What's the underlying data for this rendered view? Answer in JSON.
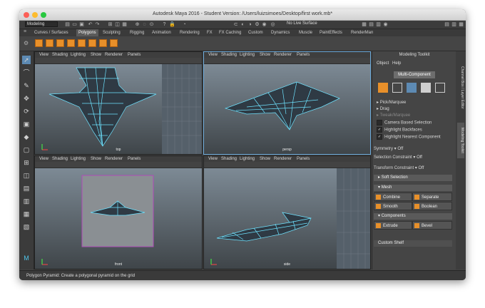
{
  "window": {
    "title": "Autodesk Maya 2016 - Student Version: /Users/luizsimoes/Desktop/first work.mb*",
    "mode": "Modeling",
    "live_surface": "No Live Surface"
  },
  "shelf_tabs": [
    "Curves / Surfaces",
    "Polygons",
    "Sculpting",
    "Rigging",
    "Animation",
    "Rendering",
    "FX",
    "FX Caching",
    "Custom",
    "Dynamics",
    "Muscle",
    "PaintEffects",
    "RenderMan"
  ],
  "active_shelf_tab": "Polygons",
  "viewport_menu": [
    "View",
    "Shading",
    "Lighting",
    "Show",
    "Renderer",
    "Panels"
  ],
  "viewports": [
    {
      "camera": "top"
    },
    {
      "camera": "persp"
    },
    {
      "camera": "front"
    },
    {
      "camera": "side"
    }
  ],
  "modeling_toolkit": {
    "title": "Modeling Toolkit",
    "menu": [
      "Object",
      "Help"
    ],
    "multi_component": "Multi-Component",
    "rows": [
      {
        "label": "Pick/Marquee"
      },
      {
        "label": "Drag"
      },
      {
        "label": "Tweak/Marquee"
      }
    ],
    "checkboxes": [
      {
        "label": "Camera Based Selection",
        "checked": false
      },
      {
        "label": "Highlight Backfaces",
        "checked": true
      },
      {
        "label": "Highlight Nearest Component",
        "checked": true
      }
    ],
    "options": [
      {
        "label": "Symmetry",
        "value": "Off"
      },
      {
        "label": "Selection Constraint",
        "value": "Off"
      },
      {
        "label": "Transform Constraint",
        "value": "Off"
      }
    ],
    "soft_selection": "Soft Selection",
    "mesh_header": "Mesh",
    "mesh_buttons": [
      "Combine",
      "Separate",
      "Smooth",
      "Boolean"
    ],
    "components_header": "Components",
    "component_buttons": [
      "Extrude",
      "Bevel"
    ],
    "custom_shelf": "Custom Shelf"
  },
  "side_tabs": [
    "Channel Box / Layer Editor",
    "Modeling Toolkit"
  ],
  "status": "Polygon Pyramid: Create a polygonal pyramid on the grid",
  "colors": {
    "accent": "#6aa8d8",
    "wire": "#6ee3ff",
    "shelf_icon": "#e8902a"
  }
}
